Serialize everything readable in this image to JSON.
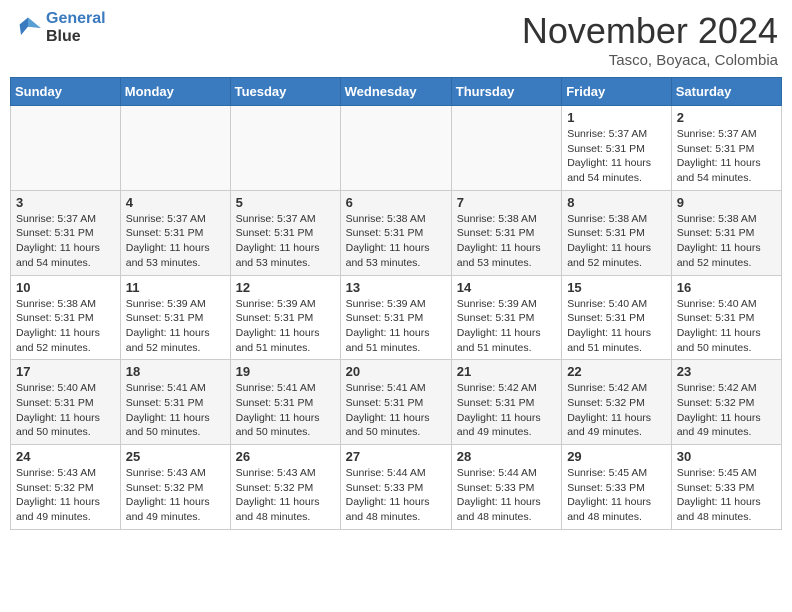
{
  "header": {
    "logo_line1": "General",
    "logo_line2": "Blue",
    "month": "November 2024",
    "location": "Tasco, Boyaca, Colombia"
  },
  "weekdays": [
    "Sunday",
    "Monday",
    "Tuesday",
    "Wednesday",
    "Thursday",
    "Friday",
    "Saturday"
  ],
  "weeks": [
    [
      {
        "day": "",
        "info": ""
      },
      {
        "day": "",
        "info": ""
      },
      {
        "day": "",
        "info": ""
      },
      {
        "day": "",
        "info": ""
      },
      {
        "day": "",
        "info": ""
      },
      {
        "day": "1",
        "info": "Sunrise: 5:37 AM\nSunset: 5:31 PM\nDaylight: 11 hours\nand 54 minutes."
      },
      {
        "day": "2",
        "info": "Sunrise: 5:37 AM\nSunset: 5:31 PM\nDaylight: 11 hours\nand 54 minutes."
      }
    ],
    [
      {
        "day": "3",
        "info": "Sunrise: 5:37 AM\nSunset: 5:31 PM\nDaylight: 11 hours\nand 54 minutes."
      },
      {
        "day": "4",
        "info": "Sunrise: 5:37 AM\nSunset: 5:31 PM\nDaylight: 11 hours\nand 53 minutes."
      },
      {
        "day": "5",
        "info": "Sunrise: 5:37 AM\nSunset: 5:31 PM\nDaylight: 11 hours\nand 53 minutes."
      },
      {
        "day": "6",
        "info": "Sunrise: 5:38 AM\nSunset: 5:31 PM\nDaylight: 11 hours\nand 53 minutes."
      },
      {
        "day": "7",
        "info": "Sunrise: 5:38 AM\nSunset: 5:31 PM\nDaylight: 11 hours\nand 53 minutes."
      },
      {
        "day": "8",
        "info": "Sunrise: 5:38 AM\nSunset: 5:31 PM\nDaylight: 11 hours\nand 52 minutes."
      },
      {
        "day": "9",
        "info": "Sunrise: 5:38 AM\nSunset: 5:31 PM\nDaylight: 11 hours\nand 52 minutes."
      }
    ],
    [
      {
        "day": "10",
        "info": "Sunrise: 5:38 AM\nSunset: 5:31 PM\nDaylight: 11 hours\nand 52 minutes."
      },
      {
        "day": "11",
        "info": "Sunrise: 5:39 AM\nSunset: 5:31 PM\nDaylight: 11 hours\nand 52 minutes."
      },
      {
        "day": "12",
        "info": "Sunrise: 5:39 AM\nSunset: 5:31 PM\nDaylight: 11 hours\nand 51 minutes."
      },
      {
        "day": "13",
        "info": "Sunrise: 5:39 AM\nSunset: 5:31 PM\nDaylight: 11 hours\nand 51 minutes."
      },
      {
        "day": "14",
        "info": "Sunrise: 5:39 AM\nSunset: 5:31 PM\nDaylight: 11 hours\nand 51 minutes."
      },
      {
        "day": "15",
        "info": "Sunrise: 5:40 AM\nSunset: 5:31 PM\nDaylight: 11 hours\nand 51 minutes."
      },
      {
        "day": "16",
        "info": "Sunrise: 5:40 AM\nSunset: 5:31 PM\nDaylight: 11 hours\nand 50 minutes."
      }
    ],
    [
      {
        "day": "17",
        "info": "Sunrise: 5:40 AM\nSunset: 5:31 PM\nDaylight: 11 hours\nand 50 minutes."
      },
      {
        "day": "18",
        "info": "Sunrise: 5:41 AM\nSunset: 5:31 PM\nDaylight: 11 hours\nand 50 minutes."
      },
      {
        "day": "19",
        "info": "Sunrise: 5:41 AM\nSunset: 5:31 PM\nDaylight: 11 hours\nand 50 minutes."
      },
      {
        "day": "20",
        "info": "Sunrise: 5:41 AM\nSunset: 5:31 PM\nDaylight: 11 hours\nand 50 minutes."
      },
      {
        "day": "21",
        "info": "Sunrise: 5:42 AM\nSunset: 5:31 PM\nDaylight: 11 hours\nand 49 minutes."
      },
      {
        "day": "22",
        "info": "Sunrise: 5:42 AM\nSunset: 5:32 PM\nDaylight: 11 hours\nand 49 minutes."
      },
      {
        "day": "23",
        "info": "Sunrise: 5:42 AM\nSunset: 5:32 PM\nDaylight: 11 hours\nand 49 minutes."
      }
    ],
    [
      {
        "day": "24",
        "info": "Sunrise: 5:43 AM\nSunset: 5:32 PM\nDaylight: 11 hours\nand 49 minutes."
      },
      {
        "day": "25",
        "info": "Sunrise: 5:43 AM\nSunset: 5:32 PM\nDaylight: 11 hours\nand 49 minutes."
      },
      {
        "day": "26",
        "info": "Sunrise: 5:43 AM\nSunset: 5:32 PM\nDaylight: 11 hours\nand 48 minutes."
      },
      {
        "day": "27",
        "info": "Sunrise: 5:44 AM\nSunset: 5:33 PM\nDaylight: 11 hours\nand 48 minutes."
      },
      {
        "day": "28",
        "info": "Sunrise: 5:44 AM\nSunset: 5:33 PM\nDaylight: 11 hours\nand 48 minutes."
      },
      {
        "day": "29",
        "info": "Sunrise: 5:45 AM\nSunset: 5:33 PM\nDaylight: 11 hours\nand 48 minutes."
      },
      {
        "day": "30",
        "info": "Sunrise: 5:45 AM\nSunset: 5:33 PM\nDaylight: 11 hours\nand 48 minutes."
      }
    ]
  ]
}
